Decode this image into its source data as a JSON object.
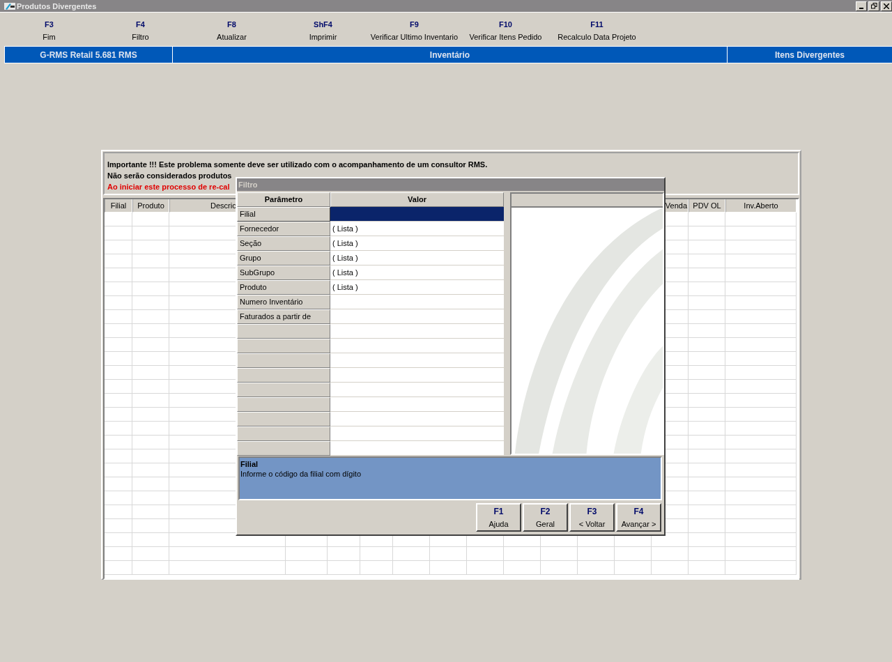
{
  "window": {
    "title": "Produtos Divergentes"
  },
  "toolbar": [
    {
      "key": "F3",
      "label": "Fim"
    },
    {
      "key": "F4",
      "label": "Filtro"
    },
    {
      "key": "F8",
      "label": "Atualizar"
    },
    {
      "key": "ShF4",
      "label": "Imprimir"
    },
    {
      "key": "F9",
      "label": "Verificar Ultimo Inventario"
    },
    {
      "key": "F10",
      "label": "Verificar Itens Pedido"
    },
    {
      "key": "F11",
      "label": "Recalculo Data Projeto"
    }
  ],
  "header_bar": {
    "product": "G-RMS Retail 5.681 RMS",
    "module": "Inventário",
    "screen": "Itens Divergentes"
  },
  "notice": [
    {
      "text": "Importante !!! Este problema somente deve ser utilizado com o acompanhamento de um consultor RMS.",
      "kind": "normal"
    },
    {
      "text": "Não serão considerados produtos",
      "kind": "normal"
    },
    {
      "text": "Ao iniciar este processo de re-cal",
      "kind": "warning"
    }
  ],
  "grid": {
    "columns_left": [
      "Filial",
      "Produto",
      "Descric"
    ],
    "columns_right": [
      "Venda",
      "PDV OL",
      "Inv.Aberto"
    ]
  },
  "dialog": {
    "title": "Filtro",
    "columns": [
      "Parâmetro",
      "Valor"
    ],
    "params": [
      {
        "name": "Filial",
        "selected": true
      },
      {
        "name": "Fornecedor",
        "value": "( Lista )",
        "selected": false
      },
      {
        "name": "Seção",
        "value": "( Lista )",
        "selected": false
      },
      {
        "name": "Grupo",
        "value": "( Lista )",
        "selected": false
      },
      {
        "name": "SubGrupo",
        "value": "( Lista )",
        "selected": false
      },
      {
        "name": "Produto",
        "value": "( Lista )",
        "selected": false
      },
      {
        "name": "Numero Inventário",
        "selected": false
      },
      {
        "name": "Faturados a partir de",
        "selected": false
      }
    ],
    "help": {
      "title": "Filial",
      "text": "Informe o código da filial com dígito"
    },
    "buttons": [
      {
        "key": "F1",
        "label": "Ajuda"
      },
      {
        "key": "F2",
        "label": "Geral"
      },
      {
        "key": "F3",
        "label": "< Voltar"
      },
      {
        "key": "F4",
        "label": "Avançar >"
      }
    ]
  }
}
